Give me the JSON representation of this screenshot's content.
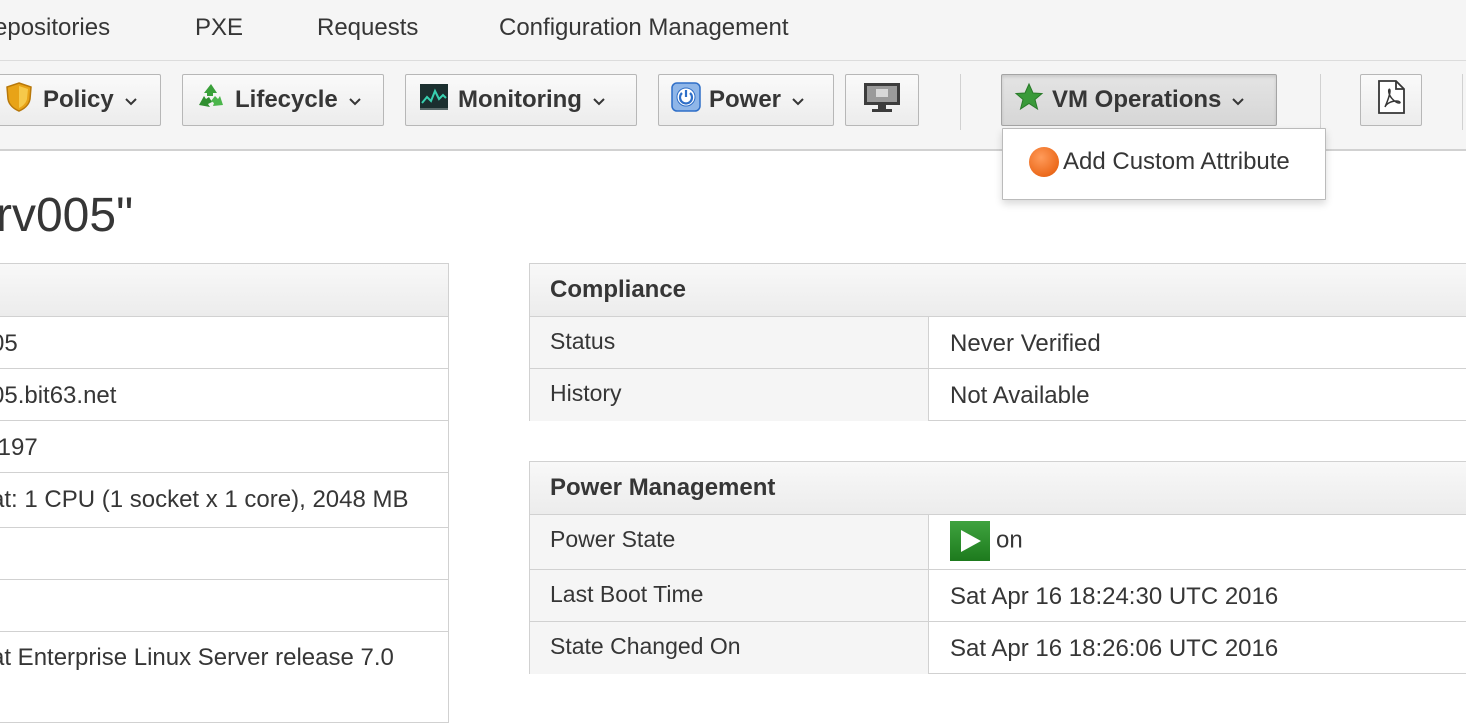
{
  "nav": {
    "items": [
      "epositories",
      "PXE",
      "Requests",
      "Configuration Management"
    ]
  },
  "toolbar": {
    "policy_label": "Policy",
    "lifecycle_label": "Lifecycle",
    "monitoring_label": "Monitoring",
    "power_label": "Power",
    "vm_operations_label": "VM Operations",
    "icons": [
      "shield-icon",
      "recycle-icon",
      "monitor-chart-icon",
      "power-icon",
      "console-icon",
      "star-icon",
      "pdf-icon"
    ],
    "colors": {
      "star": "#3a9a3a",
      "power": "#2f6fc8",
      "recycle": "#3aa03a"
    }
  },
  "dropdown": {
    "items": [
      {
        "label": "Add Custom Attribute",
        "icon": "orange-circle-icon"
      }
    ]
  },
  "page": {
    "title": "rv005\""
  },
  "left_table": {
    "rows": [
      "05",
      "05.bit63.net",
      ".197",
      "at: 1 CPU (1 socket x 1 core), 2048 MB",
      "",
      "",
      "at Enterprise Linux Server release 7.0"
    ]
  },
  "compliance": {
    "title": "Compliance",
    "rows": [
      {
        "label": "Status",
        "value": "Never Verified"
      },
      {
        "label": "History",
        "value": "Not Available"
      }
    ]
  },
  "power_management": {
    "title": "Power Management",
    "rows": [
      {
        "label": "Power State",
        "value": "on"
      },
      {
        "label": "Last Boot Time",
        "value": "Sat Apr 16 18:24:30 UTC 2016"
      },
      {
        "label": "State Changed On",
        "value": "Sat Apr 16 18:26:06 UTC 2016"
      }
    ]
  }
}
